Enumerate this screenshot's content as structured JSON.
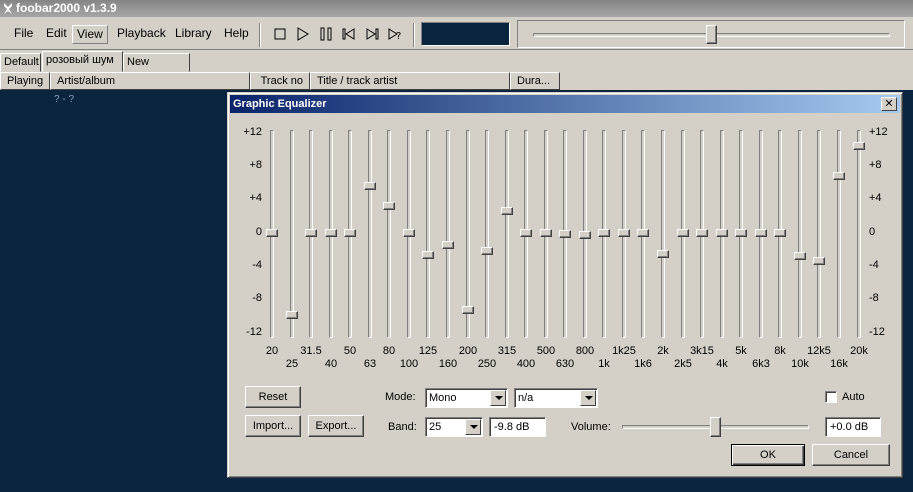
{
  "app": {
    "title": "foobar2000 v1.3.9"
  },
  "menu": [
    "File",
    "Edit",
    "View",
    "Playback",
    "Library",
    "Help"
  ],
  "toolbar": {
    "icons": [
      "stop-icon",
      "play-icon",
      "pause-icon",
      "previous-icon",
      "next-icon",
      "random-icon"
    ],
    "seek_position": 0.49
  },
  "tabs": [
    "Default",
    "розовый шум",
    "New Playlist"
  ],
  "active_tab": 1,
  "columns": [
    "Playing",
    "Artist/album",
    "Track no",
    "Title / track artist",
    "Dura..."
  ],
  "playlist_rows": [
    {
      "artist_album": "? - ?"
    }
  ],
  "dialog": {
    "title": "Graphic Equalizer",
    "scale_labels": [
      "+12",
      "+8",
      "+4",
      "0",
      "-4",
      "-8",
      "-12"
    ],
    "bands": [
      {
        "freq": "20",
        "db": 0
      },
      {
        "freq": "25",
        "db": -9.8
      },
      {
        "freq": "31.5",
        "db": 0
      },
      {
        "freq": "40",
        "db": 0
      },
      {
        "freq": "50",
        "db": 0
      },
      {
        "freq": "63",
        "db": 5.6
      },
      {
        "freq": "80",
        "db": 3.3
      },
      {
        "freq": "100",
        "db": 0
      },
      {
        "freq": "125",
        "db": -2.6
      },
      {
        "freq": "160",
        "db": -1.4
      },
      {
        "freq": "200",
        "db": -9.2
      },
      {
        "freq": "250",
        "db": -2.1
      },
      {
        "freq": "315",
        "db": 2.6
      },
      {
        "freq": "400",
        "db": 0
      },
      {
        "freq": "500",
        "db": 0
      },
      {
        "freq": "630",
        "db": -0.1
      },
      {
        "freq": "800",
        "db": -0.2
      },
      {
        "freq": "1k",
        "db": 0
      },
      {
        "freq": "1k25",
        "db": 0
      },
      {
        "freq": "1k6",
        "db": 0
      },
      {
        "freq": "2k",
        "db": -2.5
      },
      {
        "freq": "2k5",
        "db": 0
      },
      {
        "freq": "3k15",
        "db": 0
      },
      {
        "freq": "4k",
        "db": 0
      },
      {
        "freq": "5k",
        "db": 0
      },
      {
        "freq": "6k3",
        "db": 0
      },
      {
        "freq": "8k",
        "db": 0
      },
      {
        "freq": "10k",
        "db": -2.8
      },
      {
        "freq": "12k5",
        "db": -3.4
      },
      {
        "freq": "16k",
        "db": 6.9
      },
      {
        "freq": "20k",
        "db": 10.5
      }
    ],
    "reset_label": "Reset",
    "import_label": "Import...",
    "export_label": "Export...",
    "mode_label": "Mode:",
    "mode_value": "Mono",
    "mode2_value": "n/a",
    "band_label": "Band:",
    "band_value": "25",
    "band_db": "-9.8 dB",
    "volume_label": "Volume:",
    "volume_value": "+0.0 dB",
    "volume_level": 0.5,
    "auto_label": "Auto",
    "auto_checked": false,
    "ok_label": "OK",
    "cancel_label": "Cancel"
  }
}
